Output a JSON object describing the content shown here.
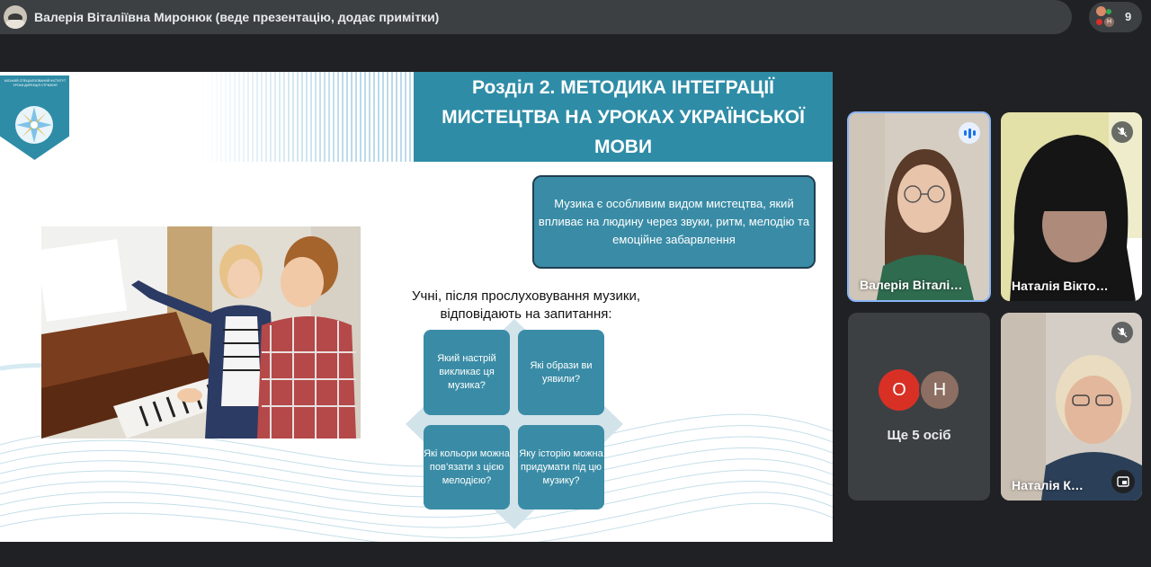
{
  "topbar": {
    "presenter_text": "Валерія Віталіївна Миронюк (веде презентацію, додає примітки)",
    "people_count": "9",
    "mini_avatar_letter": "Н"
  },
  "slide": {
    "logo_text": "МІСЬКИЙ СПЕЦІАЛІЗОВАНИЙ ІНСТИТУТ УРОКИ ДИРЕКЦІЯ СТРИЖНЯ",
    "title": "Розділ 2. МЕТОДИКА ІНТЕГРАЦІЇ МИСТЕЦТВА НА УРОКАХ УКРАЇНСЬКОЇ МОВИ",
    "info_text": "Музика є особливим видом мистецтва, який впливає на людину через звуки, ритм, мелодію та емоційне забарвлення",
    "question_text": "Учні, після прослуховування музики, відповідають на запитання:",
    "quadrants": [
      "Який настрій викликає ця музика?",
      "Які образи ви уявили?",
      "Які кольори можна пов’язати з цією мелодією?",
      "Яку історію можна придумати під цю музику?"
    ]
  },
  "participants": {
    "tile1": {
      "name": "Валерія Віталі…",
      "status": "speaking"
    },
    "tile2": {
      "name": "Наталія Вікто…",
      "status": "muted"
    },
    "tile3": {
      "letters": [
        "О",
        "Н"
      ],
      "label": "Ще 5 осіб"
    },
    "tile4": {
      "name": "Наталія К…",
      "status": "muted"
    }
  },
  "colors": {
    "accent_teal": "#2e8ca6",
    "bg_dark": "#202124",
    "speaking_blue": "#1a73e8",
    "avatar_o": "#d93025",
    "avatar_h": "#8d6e63"
  }
}
